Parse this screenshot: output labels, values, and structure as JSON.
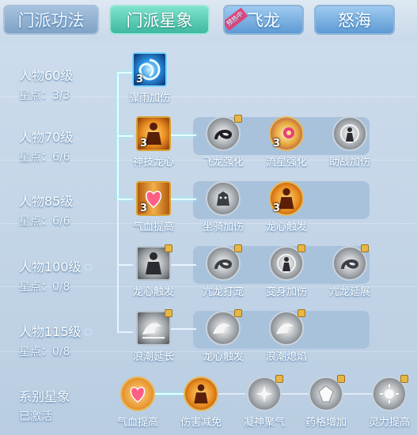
{
  "tabs": [
    "门派功法",
    "门派星象",
    "飞龙",
    "怒海"
  ],
  "ribbon": "预热中",
  "rows": [
    {
      "level": "人物60级",
      "stars": "星点：3/3"
    },
    {
      "level": "人物70级",
      "stars": "星点：6/6"
    },
    {
      "level": "人物85级",
      "stars": "星点：6/6"
    },
    {
      "level": "人物100级",
      "stars": "星点：0/8",
      "locked": true
    },
    {
      "level": "人物115级",
      "stars": "星点：0/8",
      "locked": true
    }
  ],
  "series": {
    "title": "系别星象",
    "status": "已激活"
  },
  "skills": {
    "r1": [
      {
        "name": "骤雨加伤",
        "count": "3",
        "icon": "swirl-icon"
      }
    ],
    "r2": [
      {
        "name": "神技龙心",
        "count": "3",
        "icon": "warrior-icon"
      },
      {
        "name": "飞龙强化",
        "count": "",
        "icon": "dragon-icon"
      },
      {
        "name": "流星强化",
        "count": "3",
        "icon": "meteor-icon"
      },
      {
        "name": "助战加伤",
        "count": "",
        "icon": "figure-swirl-icon"
      }
    ],
    "r3": [
      {
        "name": "气血提高",
        "count": "3",
        "icon": "heart-icon"
      },
      {
        "name": "坐骑加伤",
        "count": "",
        "icon": "beast-icon"
      },
      {
        "name": "龙心触发",
        "count": "3",
        "icon": "warrior-icon"
      }
    ],
    "r4": [
      {
        "name": "龙心触发",
        "count": "",
        "icon": "warrior-icon"
      },
      {
        "name": "亢龙打宠",
        "count": "",
        "icon": "dragon-icon"
      },
      {
        "name": "变身加伤",
        "count": "",
        "icon": "figure-swirl-icon"
      },
      {
        "name": "亢龙延展",
        "count": "",
        "icon": "dragon-icon"
      }
    ],
    "r5": [
      {
        "name": "浪潮延长",
        "count": "",
        "icon": "wave-icon"
      },
      {
        "name": "龙心触发",
        "count": "",
        "icon": "wave-icon"
      },
      {
        "name": "浪潮熄焰",
        "count": "",
        "icon": "wave-icon"
      }
    ],
    "bottom": [
      {
        "name": "气血提高",
        "icon": "heart-icon"
      },
      {
        "name": "伤害减免",
        "icon": "warrior-icon"
      },
      {
        "name": "凝神聚气",
        "icon": "spark-icon"
      },
      {
        "name": "药格增加",
        "icon": "crystal-icon"
      },
      {
        "name": "灵力提高",
        "icon": "sun-icon"
      }
    ]
  }
}
